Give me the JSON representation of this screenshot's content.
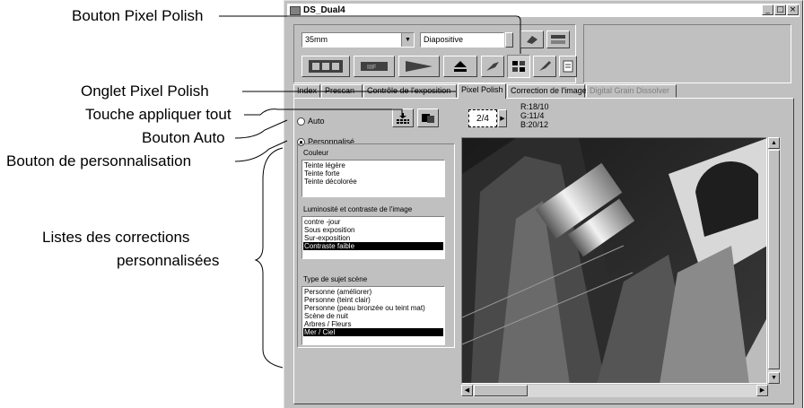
{
  "callouts": {
    "pixel_polish_button": "Bouton Pixel Polish",
    "pixel_polish_tab": "Onglet Pixel Polish",
    "apply_all_key": "Touche appliquer tout",
    "auto_button": "Bouton Auto",
    "custom_button": "Bouton de personnalisation",
    "custom_lists_line1": "Listes des corrections",
    "custom_lists_line2": "personnalisées"
  },
  "window": {
    "title": "DS_Dual4",
    "minimize_glyph": "_",
    "maximize_glyph": "□",
    "close_glyph": "×"
  },
  "toolbar": {
    "film_format": "35mm",
    "film_type": "Diapositive"
  },
  "tabs": [
    {
      "label": "Index",
      "state": "partial"
    },
    {
      "label": "Prescan",
      "state": "partial"
    },
    {
      "label": "Contrôle de l'exposition",
      "state": "partial"
    },
    {
      "label": "Pixel Polish",
      "state": "active"
    },
    {
      "label": "Correction de l'image",
      "state": "normal"
    },
    {
      "label": "Digital Grain Dissolver",
      "state": "disabled"
    }
  ],
  "pixel_polish": {
    "auto_label": "Auto",
    "custom_label": "Personnalisé",
    "frame_counter": "2/4",
    "readout_r": "R:18/10",
    "readout_g": "G:11/4",
    "readout_b": "B:20/12",
    "color_group": {
      "label": "Couleur",
      "items": [
        "Teinte légère",
        "Teinte forte",
        "Teinte décolorée"
      ],
      "selected": -1
    },
    "brightness_group": {
      "label": "Luminosité et contraste de l'image",
      "items": [
        "contre -jour",
        "Sous exposition",
        "Sur-exposition",
        "Contraste faible"
      ],
      "selected": 3
    },
    "subject_group": {
      "label": "Type de sujet  scène",
      "items": [
        "Personne (améliorer)",
        "Personne (teint clair)",
        "Personne (peau bronzée ou teint mat)",
        "Scène de nuit",
        "Arbres / Fleurs",
        "Mer / Ciel"
      ],
      "selected": 5
    }
  },
  "icons": {
    "apply_all": "apply-all-icon",
    "compare": "compare-icon",
    "pixel_polish": "pixel-polish-icon"
  }
}
